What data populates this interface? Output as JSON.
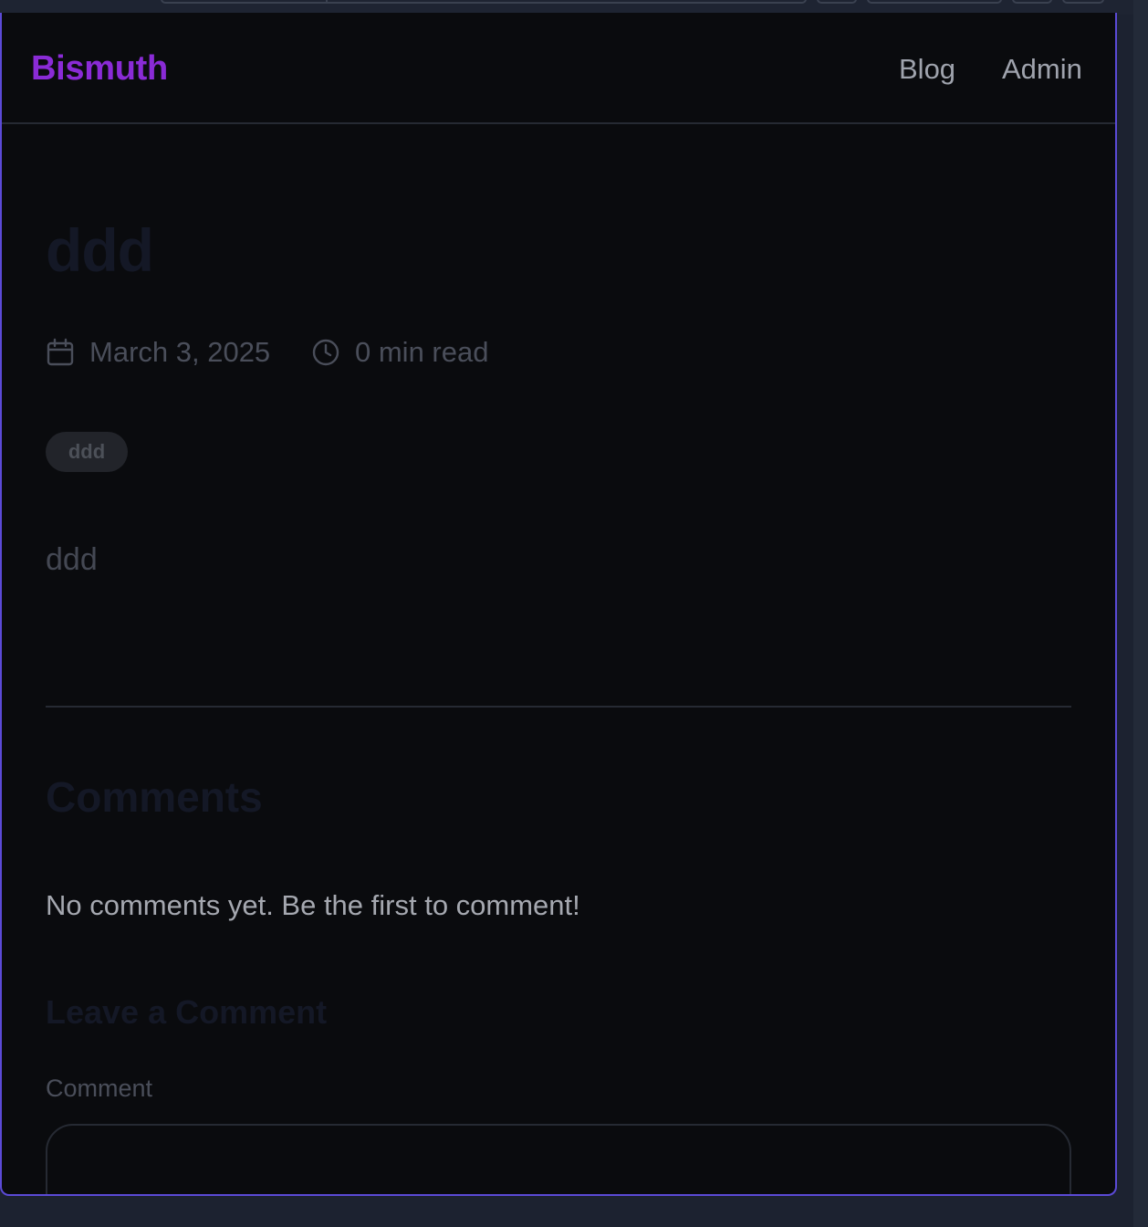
{
  "header": {
    "brand": "Bismuth",
    "nav": [
      {
        "label": "Blog"
      },
      {
        "label": "Admin"
      }
    ]
  },
  "post": {
    "title": "ddd",
    "date": "March 3, 2025",
    "read_time": "0 min read",
    "tags": [
      "ddd"
    ],
    "body": "ddd"
  },
  "comments": {
    "heading": "Comments",
    "empty_message": "No comments yet. Be the first to comment!",
    "form_heading": "Leave a Comment",
    "comment_label": "Comment",
    "comment_value": ""
  },
  "colors": {
    "brand": "#8a2bd6",
    "accent_border": "#5b4ad6",
    "background": "#0a0b0e"
  },
  "icons": {
    "date": "calendar-icon",
    "read_time": "clock-icon"
  }
}
